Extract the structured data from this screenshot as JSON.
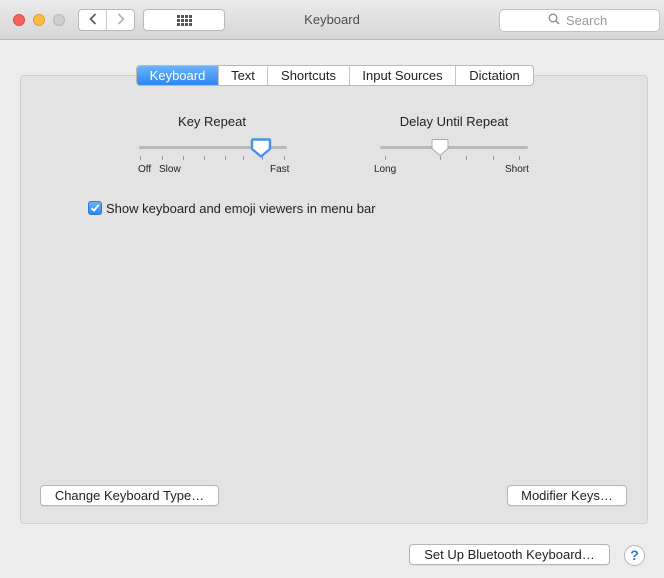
{
  "window": {
    "title": "Keyboard"
  },
  "search": {
    "placeholder": "Search"
  },
  "tabs": [
    {
      "label": "Keyboard",
      "active": true
    },
    {
      "label": "Text",
      "active": false
    },
    {
      "label": "Shortcuts",
      "active": false
    },
    {
      "label": "Input Sources",
      "active": false
    },
    {
      "label": "Dictation",
      "active": false
    }
  ],
  "key_repeat": {
    "label": "Key Repeat",
    "min_label_a": "Off",
    "min_label_b": "Slow",
    "max_label": "Fast",
    "value_fraction": 0.83
  },
  "delay_until_repeat": {
    "label": "Delay Until Repeat",
    "min_label": "Long",
    "max_label": "Short",
    "value_fraction": 0.4
  },
  "viewer_option": {
    "label": "Show keyboard and emoji viewers in menu bar",
    "checked": true
  },
  "buttons": {
    "change_type": "Change Keyboard Type…",
    "modifier_keys": "Modifier Keys…",
    "bluetooth": "Set Up Bluetooth Keyboard…",
    "help": "?"
  },
  "colors": {
    "accent": "#2c87f2",
    "close": "#fc605c",
    "minimize": "#fdbc40",
    "zoom_disabled": "#cfcfcf"
  }
}
